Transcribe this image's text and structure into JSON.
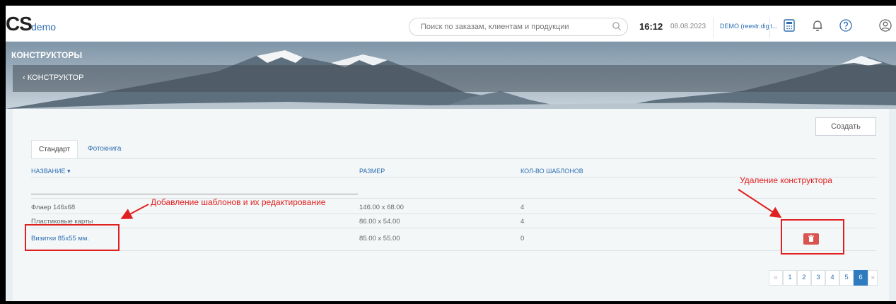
{
  "app": {
    "logo_mark": "CS",
    "logo_text": "demo"
  },
  "search": {
    "placeholder": "Поиск по заказам, клиентам и продукции"
  },
  "clock": {
    "time": "16:12",
    "date": "08.08.2023"
  },
  "user": {
    "label": "DEMO (reestr.digit..."
  },
  "page": {
    "title": "КОНСТРУКТОРЫ",
    "breadcrumb": "КОНСТРУКТОР"
  },
  "actions": {
    "create_label": "Создать"
  },
  "tabs": [
    {
      "label": "Стандарт"
    },
    {
      "label": "Фотокнига"
    }
  ],
  "table": {
    "columns": [
      "НАЗВАНИЕ ▾",
      "РАЗМЕР",
      "КОЛ-ВО ШАБЛОНОВ"
    ],
    "rows": [
      {
        "name": "Флаер 146x68",
        "size": "146.00 x 68.00",
        "count": "4"
      },
      {
        "name": "Пластиковые карты",
        "size": "86.00 x 54.00",
        "count": "4"
      },
      {
        "name": "Визитки 85x55 мм.",
        "size": "85.00 x 55.00",
        "count": "0"
      }
    ]
  },
  "pagination": {
    "prev": "«",
    "pages": [
      "1",
      "2",
      "3",
      "4",
      "5",
      "6"
    ],
    "next": "»",
    "current": "6"
  },
  "annotations": {
    "add_templates": "Добавление шаблонов и их редактирование",
    "delete_constructor": "Удаление конструктора"
  },
  "colors": {
    "accent": "#2f6fb2",
    "danger": "#d9534f",
    "annotation": "#e02020",
    "active_page": "#2f7bbf"
  },
  "icons": [
    "search-icon",
    "calculator-icon",
    "bell-icon",
    "help-icon",
    "user-icon",
    "chevron-left-icon",
    "trash-icon"
  ]
}
